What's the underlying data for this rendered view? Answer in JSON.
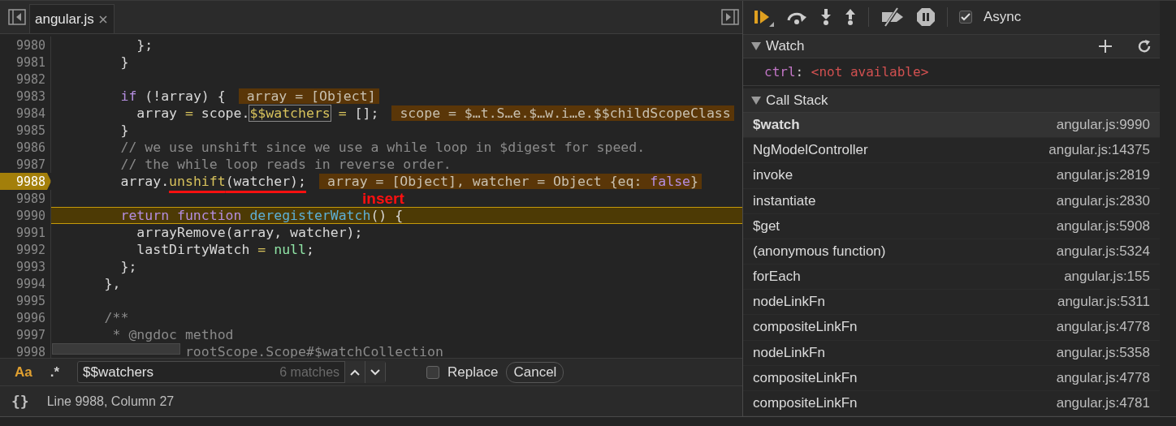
{
  "editor": {
    "tabs": [
      {
        "label": "angular.js",
        "selected": true
      }
    ],
    "lines": [
      {
        "number": "9980",
        "tokens": [
          {
            "text": "          };",
            "kind": "plain"
          }
        ]
      },
      {
        "number": "9981",
        "tokens": [
          {
            "text": "        }",
            "kind": "plain"
          }
        ]
      },
      {
        "number": "9982"
      },
      {
        "number": "9983",
        "tokens": [
          {
            "text": "        if",
            "kind": "keyword"
          },
          {
            "text": " (!array) {",
            "kind": "plain"
          }
        ],
        "values": [
          {
            "text": "array = [Object]",
            "kind": "plain"
          }
        ]
      },
      {
        "number": "9984",
        "tokens": [
          {
            "text": "          array ",
            "kind": "plain"
          },
          {
            "text": "=",
            "kind": "op"
          },
          {
            "text": " scope.",
            "kind": "plain"
          },
          {
            "text": "$$watchers",
            "kind": "match"
          },
          {
            "text": " =",
            "kind": "op"
          },
          {
            "text": " [];",
            "kind": "plain"
          }
        ],
        "values": [
          {
            "text": "scope = $…t.S…e.$…w.i…e.$$childScopeClass",
            "kind": "plain"
          }
        ]
      },
      {
        "number": "9985",
        "tokens": [
          {
            "text": "        }",
            "kind": "plain"
          }
        ]
      },
      {
        "number": "9986",
        "tokens": [
          {
            "text": "        // we use unshift since we use a while loop in $digest for speed.",
            "kind": "comment"
          }
        ]
      },
      {
        "number": "9987",
        "tokens": [
          {
            "text": "        // the while loop reads in reverse order.",
            "kind": "comment"
          }
        ]
      },
      {
        "number": "9988",
        "breakpoint": true,
        "tokens": [
          {
            "text": "        array.",
            "kind": "plain"
          },
          {
            "text": "unshift",
            "kind": "prop",
            "underlined": true
          },
          {
            "text": "(watcher);",
            "kind": "plain",
            "underlined": true
          }
        ],
        "values": [
          {
            "text": "array = [Object], watcher = Object {eq: ",
            "kind": "plain"
          },
          {
            "text": "false",
            "kind": "keyword"
          },
          {
            "text": "}",
            "kind": "plain"
          }
        ]
      },
      {
        "number": "9989"
      },
      {
        "number": "9990",
        "current": true,
        "tokens": [
          {
            "text": "        return function",
            "kind": "keyword"
          },
          {
            "text": " deregisterWatch",
            "kind": "fn"
          },
          {
            "text": "() {",
            "kind": "plain"
          }
        ]
      },
      {
        "number": "9991",
        "tokens": [
          {
            "text": "          arrayRemove(array, watcher);",
            "kind": "plain"
          }
        ]
      },
      {
        "number": "9992",
        "tokens": [
          {
            "text": "          lastDirtyWatch ",
            "kind": "plain"
          },
          {
            "text": "=",
            "kind": "op"
          },
          {
            "text": " null",
            "kind": "literal"
          },
          {
            "text": ";",
            "kind": "plain"
          }
        ]
      },
      {
        "number": "9993",
        "tokens": [
          {
            "text": "        };",
            "kind": "plain"
          }
        ]
      },
      {
        "number": "9994",
        "tokens": [
          {
            "text": "      },",
            "kind": "plain"
          }
        ]
      },
      {
        "number": "9995"
      },
      {
        "number": "9996",
        "tokens": [
          {
            "text": "      /**",
            "kind": "comment"
          }
        ]
      },
      {
        "number": "9997",
        "tokens": [
          {
            "text": "       * @ngdoc method",
            "kind": "comment"
          }
        ]
      },
      {
        "number": "9998",
        "tokens": [
          {
            "text": "                rootScope.Scope#$watchCollection",
            "kind": "comment"
          }
        ]
      }
    ],
    "annotation": "insert",
    "search": {
      "case_label": "Aa",
      "case_on": true,
      "regex_label": ".*",
      "value": "$$watchers",
      "matches": "6 matches",
      "replace_label": "Replace",
      "replace_checked": false,
      "cancel": "Cancel"
    },
    "status": {
      "braces": "{}",
      "position": "Line 9988, Column 27"
    }
  },
  "debugger": {
    "async": {
      "label": "Async",
      "checked": true
    },
    "watch": {
      "title": "Watch",
      "expanded": true,
      "items": [
        {
          "name": "ctrl",
          "separator": ":",
          "value": "<not available>"
        }
      ]
    },
    "call_stack": {
      "title": "Call Stack",
      "expanded": true,
      "frames": [
        {
          "name": "$watch",
          "location": "angular.js:9990",
          "selected": true
        },
        {
          "name": "NgModelController",
          "location": "angular.js:14375",
          "selected": false
        },
        {
          "name": "invoke",
          "location": "angular.js:2819",
          "selected": false
        },
        {
          "name": "instantiate",
          "location": "angular.js:2830",
          "selected": false
        },
        {
          "name": "$get",
          "location": "angular.js:5908",
          "selected": false
        },
        {
          "name": "(anonymous function)",
          "location": "angular.js:5324",
          "selected": false
        },
        {
          "name": "forEach",
          "location": "angular.js:155",
          "selected": false
        },
        {
          "name": "nodeLinkFn",
          "location": "angular.js:5311",
          "selected": false
        },
        {
          "name": "compositeLinkFn",
          "location": "angular.js:4778",
          "selected": false
        },
        {
          "name": "nodeLinkFn",
          "location": "angular.js:5358",
          "selected": false
        },
        {
          "name": "compositeLinkFn",
          "location": "angular.js:4778",
          "selected": false
        },
        {
          "name": "compositeLinkFn",
          "location": "angular.js:4781",
          "selected": false
        }
      ]
    }
  }
}
